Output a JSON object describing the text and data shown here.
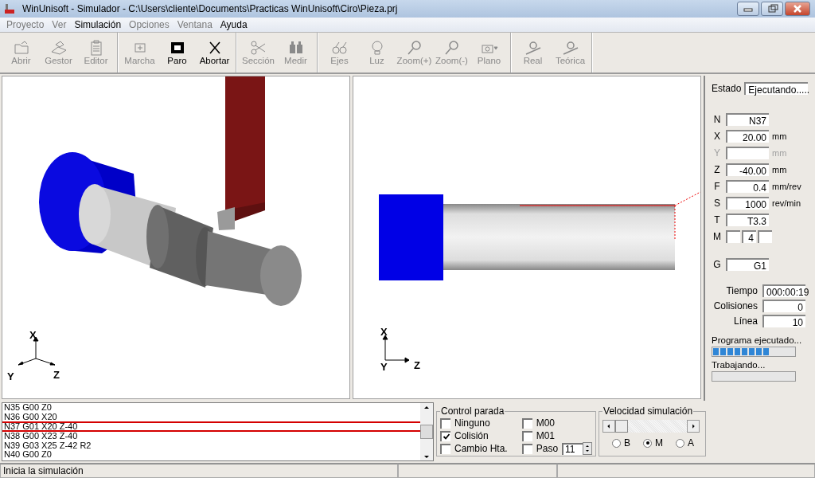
{
  "window": {
    "title": "WinUnisoft - Simulador - C:\\Users\\cliente\\Documents\\Practicas WinUnisoft\\Ciro\\Pieza.prj"
  },
  "menu": [
    {
      "label": "Proyecto",
      "disabled": true
    },
    {
      "label": "Ver",
      "disabled": true
    },
    {
      "label": "Simulación",
      "disabled": false
    },
    {
      "label": "Opciones",
      "disabled": true
    },
    {
      "label": "Ventana",
      "disabled": true
    },
    {
      "label": "Ayuda",
      "disabled": false
    }
  ],
  "toolbar": [
    [
      {
        "label": "Abrir",
        "disabled": true
      },
      {
        "label": "Gestor",
        "disabled": true
      },
      {
        "label": "Editor",
        "disabled": true
      }
    ],
    [
      {
        "label": "Marcha",
        "disabled": true
      },
      {
        "label": "Paro",
        "disabled": false
      },
      {
        "label": "Abortar",
        "disabled": false
      }
    ],
    [
      {
        "label": "Sección",
        "disabled": true
      },
      {
        "label": "Medir",
        "disabled": true
      }
    ],
    [
      {
        "label": "Ejes",
        "disabled": true
      },
      {
        "label": "Luz",
        "disabled": true
      },
      {
        "label": "Zoom(+)",
        "disabled": true
      },
      {
        "label": "Zoom(-)",
        "disabled": true
      },
      {
        "label": "Plano",
        "disabled": true
      }
    ],
    [
      {
        "label": "Real",
        "disabled": true
      },
      {
        "label": "Teórica",
        "disabled": true
      }
    ]
  ],
  "view_3d": {
    "axes": [
      "X",
      "Y",
      "Z"
    ]
  },
  "view_2d": {
    "axes": [
      "X",
      "Y",
      "Z"
    ]
  },
  "panel": {
    "estado": {
      "label": "Estado",
      "value": "Ejecutando....."
    },
    "fields": [
      {
        "label": "N",
        "value": "N37",
        "disabled": false
      },
      {
        "label": "X",
        "value": "20.00",
        "unit": "mm",
        "disabled": false
      },
      {
        "label": "Y",
        "unit": "mm",
        "disabled": true
      },
      {
        "label": "Z",
        "value": "-40.00",
        "unit": "mm",
        "disabled": false
      },
      {
        "label": "F",
        "value": "0.4",
        "unit": "mm/rev",
        "disabled": false
      },
      {
        "label": "S",
        "value": "1000",
        "unit": "rev/min",
        "disabled": false
      },
      {
        "label": "T",
        "value": "T3.3",
        "disabled": false
      }
    ],
    "m": {
      "label": "M",
      "value": "4"
    },
    "g": {
      "label": "G",
      "value": "G1"
    },
    "stats": [
      {
        "label": "Tiempo",
        "value": "000:00:19"
      },
      {
        "label": "Colisiones",
        "value": "0"
      },
      {
        "label": "Línea",
        "value": "10"
      }
    ],
    "progress": [
      {
        "label": "Programa ejecutado...",
        "level": 0.7
      },
      {
        "label": "Trabajando...",
        "level": 0
      }
    ]
  },
  "program": [
    {
      "text": "N35 G00 Z0",
      "selected": false
    },
    {
      "text": "N36 G00 X20",
      "selected": false
    },
    {
      "text": "N37 G01 X20 Z-40",
      "selected": true
    },
    {
      "text": "N38 G00 X23 Z-40",
      "selected": false
    },
    {
      "text": "N39 G03 X25 Z-42 R2",
      "selected": false
    },
    {
      "text": "N40 G00 Z0",
      "selected": false
    }
  ],
  "control_parada": {
    "title": "Control parada",
    "options": [
      {
        "label": "Ninguno",
        "checked": false
      },
      {
        "label": "Colisión",
        "checked": true
      },
      {
        "label": "Cambio Hta.",
        "checked": false
      },
      {
        "label": "M00",
        "checked": false
      },
      {
        "label": "M01",
        "checked": false
      },
      {
        "label": "Paso",
        "checked": false,
        "value": "11"
      }
    ]
  },
  "velocidad": {
    "title": "Velocidad simulación",
    "level": 0.0,
    "options": [
      {
        "label": "B",
        "selected": false
      },
      {
        "label": "M",
        "selected": true
      },
      {
        "label": "A",
        "selected": false
      }
    ]
  },
  "status_bar": {
    "text": "Inicia la simulación"
  }
}
